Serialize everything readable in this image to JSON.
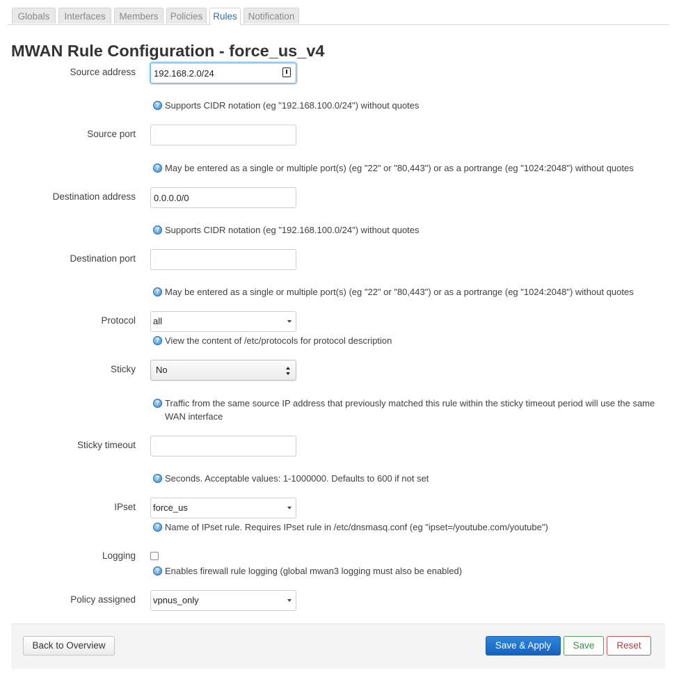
{
  "tabs": [
    {
      "label": "Globals"
    },
    {
      "label": "Interfaces"
    },
    {
      "label": "Members"
    },
    {
      "label": "Policies"
    },
    {
      "label": "Rules",
      "active": true
    },
    {
      "label": "Notification"
    }
  ],
  "page": {
    "title": "MWAN Rule Configuration - force_us_v4"
  },
  "fields": {
    "source_address": {
      "label": "Source address",
      "value": "192.168.2.0/24",
      "help": "Supports CIDR notation (eg \"192.168.100.0/24\") without quotes"
    },
    "source_port": {
      "label": "Source port",
      "value": "",
      "help": "May be entered as a single or multiple port(s) (eg \"22\" or \"80,443\") or as a portrange (eg \"1024:2048\") without quotes"
    },
    "destination_address": {
      "label": "Destination address",
      "value": "0.0.0.0/0",
      "help": "Supports CIDR notation (eg \"192.168.100.0/24\") without quotes"
    },
    "destination_port": {
      "label": "Destination port",
      "value": "",
      "help": "May be entered as a single or multiple port(s) (eg \"22\" or \"80,443\") or as a portrange (eg \"1024:2048\") without quotes"
    },
    "protocol": {
      "label": "Protocol",
      "value": "all",
      "help": "View the content of /etc/protocols for protocol description"
    },
    "sticky": {
      "label": "Sticky",
      "value": "No",
      "help": "Traffic from the same source IP address that previously matched this rule within the sticky timeout period will use the same WAN interface"
    },
    "sticky_timeout": {
      "label": "Sticky timeout",
      "value": "",
      "help": "Seconds. Acceptable values: 1-1000000. Defaults to 600 if not set"
    },
    "ipset": {
      "label": "IPset",
      "value": "force_us",
      "help": "Name of IPset rule. Requires IPset rule in /etc/dnsmasq.conf (eg \"ipset=/youtube.com/youtube\")"
    },
    "logging": {
      "label": "Logging",
      "checked": false,
      "help": "Enables firewall rule logging (global mwan3 logging must also be enabled)"
    },
    "policy_assigned": {
      "label": "Policy assigned",
      "value": "vpnus_only"
    }
  },
  "help_icon_glyph": "?",
  "footer": {
    "back_label": "Back to Overview",
    "save_apply_label": "Save & Apply",
    "save_label": "Save",
    "reset_label": "Reset"
  },
  "colors": {
    "accent": "#1c6cc7",
    "save": "#3b8e3b",
    "reset": "#bf3a3a",
    "active_tab": "#2a6fa8"
  },
  "icons": {
    "help": "info-circle-icon",
    "select": "chevron-down-icon",
    "stepper": "updown-arrows-icon",
    "autofill": "key-icon"
  }
}
